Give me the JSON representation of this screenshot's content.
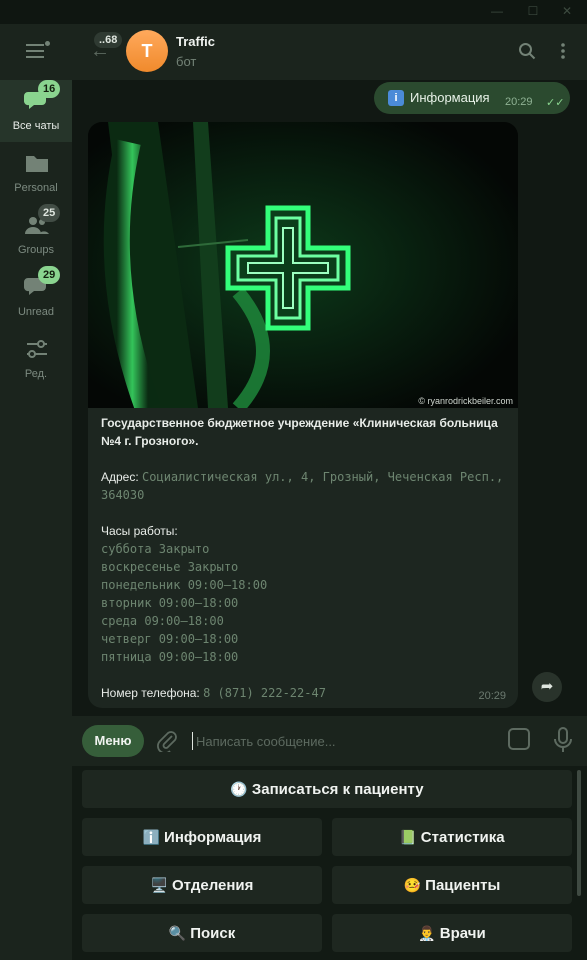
{
  "chat": {
    "title": "Traffic",
    "subtitle": "бот",
    "avatar_letter": "T",
    "back_unread": "..68"
  },
  "sidebar": {
    "folders": [
      {
        "label": "Все чаты",
        "badge": "16",
        "icon": "chats-icon",
        "active": true
      },
      {
        "label": "Personal",
        "badge": "",
        "icon": "folder-icon",
        "active": false
      },
      {
        "label": "Groups",
        "badge": "25",
        "icon": "groups-icon",
        "active": false
      },
      {
        "label": "Unread",
        "badge": "29",
        "icon": "unread-icon",
        "active": false
      },
      {
        "label": "Ред.",
        "badge": "",
        "icon": "edit-filters-icon",
        "active": false
      }
    ]
  },
  "outgoing": {
    "icon": "i",
    "text": "Информация",
    "time": "20:29"
  },
  "incoming": {
    "photo_credit": "© ryanrodrickbeiler.com",
    "title": "Государственное бюджетное учреждение «Клиническая больница №4 г. Грозного».",
    "address_label": "Адрес:",
    "address_value": "Социалистическая ул., 4, Грозный, Чеченская Респ., 364030",
    "hours_label": "Часы работы:",
    "hours": [
      "суббота Закрыто",
      "воскресенье Закрыто",
      "понедельник 09:00–18:00",
      "вторник 09:00–18:00",
      "среда 09:00–18:00",
      "четверг 09:00–18:00",
      "пятница 09:00–18:00"
    ],
    "phone_label": "Номер телефона:",
    "phone_value": "8 (871) 222-22-47",
    "time": "20:29"
  },
  "input": {
    "menu_label": "Меню",
    "placeholder": "Написать сообщение..."
  },
  "keyboard": {
    "book": {
      "emoji": "🕐",
      "label": "Записаться к пациенту"
    },
    "info": {
      "emoji": "ℹ️",
      "label": "Информация"
    },
    "stats": {
      "emoji": "📗",
      "label": "Статистика"
    },
    "departments": {
      "emoji": "🖥️",
      "label": "Отделения"
    },
    "patients": {
      "emoji": "🤒",
      "label": "Пациенты"
    },
    "search": {
      "emoji": "🔍",
      "label": "Поиск"
    },
    "doctors": {
      "emoji": "👨‍⚕️",
      "label": "Врачи"
    }
  },
  "colors": {
    "accent": "#8ad48f",
    "outgoing_bubble": "#2b4a2f",
    "neon_cross": "#2bd46a"
  }
}
